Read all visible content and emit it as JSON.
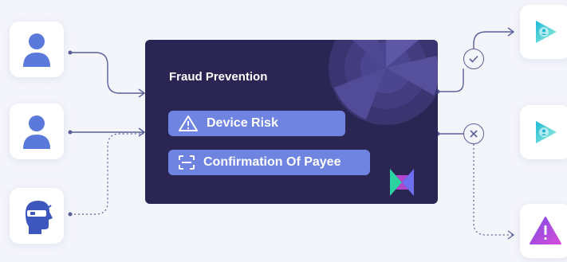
{
  "panel": {
    "title": "Fraud Prevention",
    "checks": [
      {
        "label": "Device Risk",
        "icon": "warning-triangle-icon"
      },
      {
        "label": "Confirmation Of Payee",
        "icon": "scan-frame-icon"
      }
    ]
  },
  "inputs": [
    {
      "icon": "user-icon"
    },
    {
      "icon": "user-icon"
    },
    {
      "icon": "fraudster-masked-icon"
    }
  ],
  "outputs": [
    {
      "icon": "play-profile-icon",
      "via": "check-icon"
    },
    {
      "icon": "play-profile-icon",
      "via": "cross-icon"
    },
    {
      "icon": "alert-triangle-icon"
    }
  ],
  "colors": {
    "panel": "#2a2553",
    "chip": "#6f83e0",
    "wire": "#58609a",
    "user": "#5b78db",
    "play_a": "#1fb7d6",
    "play_b": "#9bf3dd",
    "alert_a": "#7c4ee4",
    "alert_b": "#d64bd9"
  }
}
